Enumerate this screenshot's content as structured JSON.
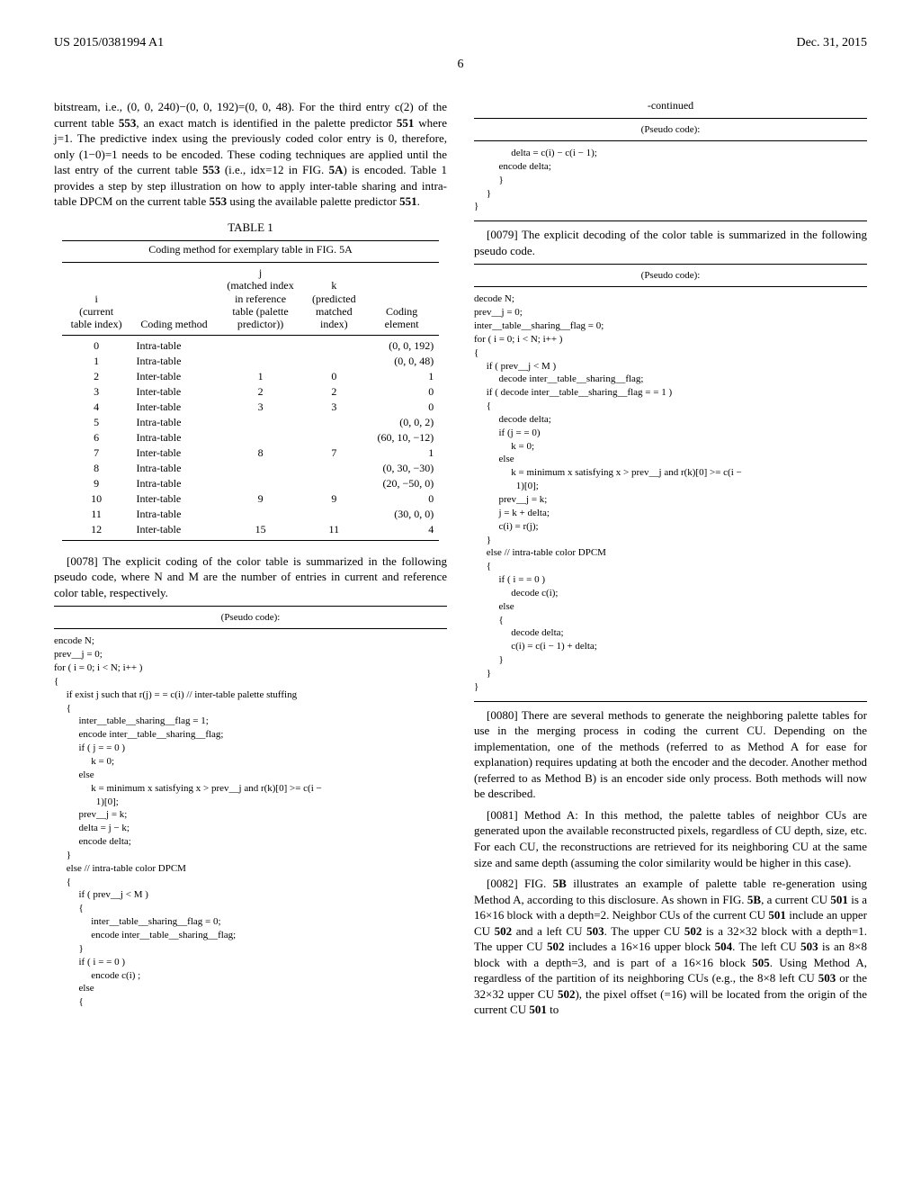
{
  "header": {
    "left": "US 2015/0381994 A1",
    "right": "Dec. 31, 2015",
    "page": "6"
  },
  "col1": {
    "para1": "bitstream, i.e., (0, 0, 240)−(0, 0, 192)=(0, 0, 48). For the third entry c(2) of the current table 553, an exact match is identified in the palette predictor 551 where j=1. The predictive index using the previously coded color entry is 0, therefore, only (1−0)=1 needs to be encoded. These coding techniques are applied until the last entry of the current table 553 (i.e., idx=12 in FIG. 5A) is encoded. Table 1 provides a step by step illustration on how to apply inter-table sharing and intra-table DPCM on the current table 553 using the available palette predictor 551.",
    "table1": {
      "title": "TABLE 1",
      "caption": "Coding method for exemplary table in FIG. 5A",
      "headers": [
        "i\n(current\ntable index)",
        "Coding method",
        "j\n(matched index\nin reference\ntable (palette\npredictor))",
        "k\n(predicted\nmatched\nindex)",
        "Coding\nelement"
      ],
      "rows": [
        [
          "0",
          "Intra-table",
          "",
          "",
          "(0, 0, 192)"
        ],
        [
          "1",
          "Intra-table",
          "",
          "",
          "(0, 0, 48)"
        ],
        [
          "2",
          "Inter-table",
          "1",
          "0",
          "1"
        ],
        [
          "3",
          "Inter-table",
          "2",
          "2",
          "0"
        ],
        [
          "4",
          "Inter-table",
          "3",
          "3",
          "0"
        ],
        [
          "5",
          "Intra-table",
          "",
          "",
          "(0, 0, 2)"
        ],
        [
          "6",
          "Intra-table",
          "",
          "",
          "(60, 10, −12)"
        ],
        [
          "7",
          "Inter-table",
          "8",
          "7",
          "1"
        ],
        [
          "8",
          "Intra-table",
          "",
          "",
          "(0, 30, −30)"
        ],
        [
          "9",
          "Intra-table",
          "",
          "",
          "(20, −50, 0)"
        ],
        [
          "10",
          "Inter-table",
          "9",
          "9",
          "0"
        ],
        [
          "11",
          "Intra-table",
          "",
          "",
          "(30, 0, 0)"
        ],
        [
          "12",
          "Inter-table",
          "15",
          "11",
          "4"
        ]
      ]
    },
    "para0078": "[0078]   The explicit coding of the color table is summarized in the following pseudo code, where N and M are the number of entries in current and reference color table, respectively.",
    "pseudo1_label": "(Pseudo code):",
    "pseudo1": "encode N;\nprev__j = 0;\nfor ( i = 0; i < N; i++ )\n{\n     if exist j such that r(j) = = c(i) // inter-table palette stuffing\n     {\n          inter__table__sharing__flag = 1;\n          encode inter__table__sharing__flag;\n          if ( j = = 0 )\n               k = 0;\n          else\n               k = minimum x satisfying x > prev__j and r(k)[0] >= c(i −\n                 1)[0];\n          prev__j = k;\n          delta = j − k;\n          encode delta;\n     }\n     else // intra-table color DPCM\n     {\n          if ( prev__j < M )\n          {\n               inter__table__sharing__flag = 0;\n               encode inter__table__sharing__flag;\n          }\n          if ( i = = 0 )\n               encode c(i) ;\n          else\n          {"
  },
  "col2": {
    "continued": "-continued",
    "pseudo1b_label": "(Pseudo code):",
    "pseudo1b": "               delta = c(i) − c(i − 1);\n          encode delta;\n          }\n     }\n}",
    "para0079": "[0079]   The explicit decoding of the color table is summarized in the following pseudo code.",
    "pseudo2_label": "(Pseudo code):",
    "pseudo2": "decode N;\nprev__j = 0;\ninter__table__sharing__flag = 0;\nfor ( i = 0; i < N; i++ )\n{\n     if ( prev__j < M )\n          decode inter__table__sharing__flag;\n     if ( decode inter__table__sharing__flag = = 1 )\n     {\n          decode delta;\n          if (j = = 0)\n               k = 0;\n          else\n               k = minimum x satisfying x > prev__j and r(k)[0] >= c(i −\n                 1)[0];\n          prev__j = k;\n          j = k + delta;\n          c(i) = r(j);\n     }\n     else // intra-table color DPCM\n     {\n          if ( i = = 0 )\n               decode c(i);\n          else\n          {\n               decode delta;\n               c(i) = c(i − 1) + delta;\n          }\n     }\n}",
    "para0080": "[0080]   There are several methods to generate the neighboring palette tables for use in the merging process in coding the current CU. Depending on the implementation, one of the methods (referred to as Method A for ease for explanation) requires updating at both the encoder and the decoder. Another method (referred to as Method B) is an encoder side only process. Both methods will now be described.",
    "para0081": "[0081]   Method A: In this method, the palette tables of neighbor CUs are generated upon the available reconstructed pixels, regardless of CU depth, size, etc. For each CU, the reconstructions are retrieved for its neighboring CU at the same size and same depth (assuming the color similarity would be higher in this case).",
    "para0082": "[0082]   FIG. 5B illustrates an example of palette table re-generation using Method A, according to this disclosure. As shown in FIG. 5B, a current CU 501 is a 16×16 block with a depth=2. Neighbor CUs of the current CU 501 include an upper CU 502 and a left CU 503. The upper CU 502 is a 32×32 block with a depth=1. The upper CU 502 includes a 16×16 upper block 504. The left CU 503 is an 8×8 block with a depth=3, and is part of a 16×16 block 505. Using Method A, regardless of the partition of its neighboring CUs (e.g., the 8×8 left CU 503 or the 32×32 upper CU 502), the pixel offset (=16) will be located from the origin of the current CU 501 to"
  }
}
